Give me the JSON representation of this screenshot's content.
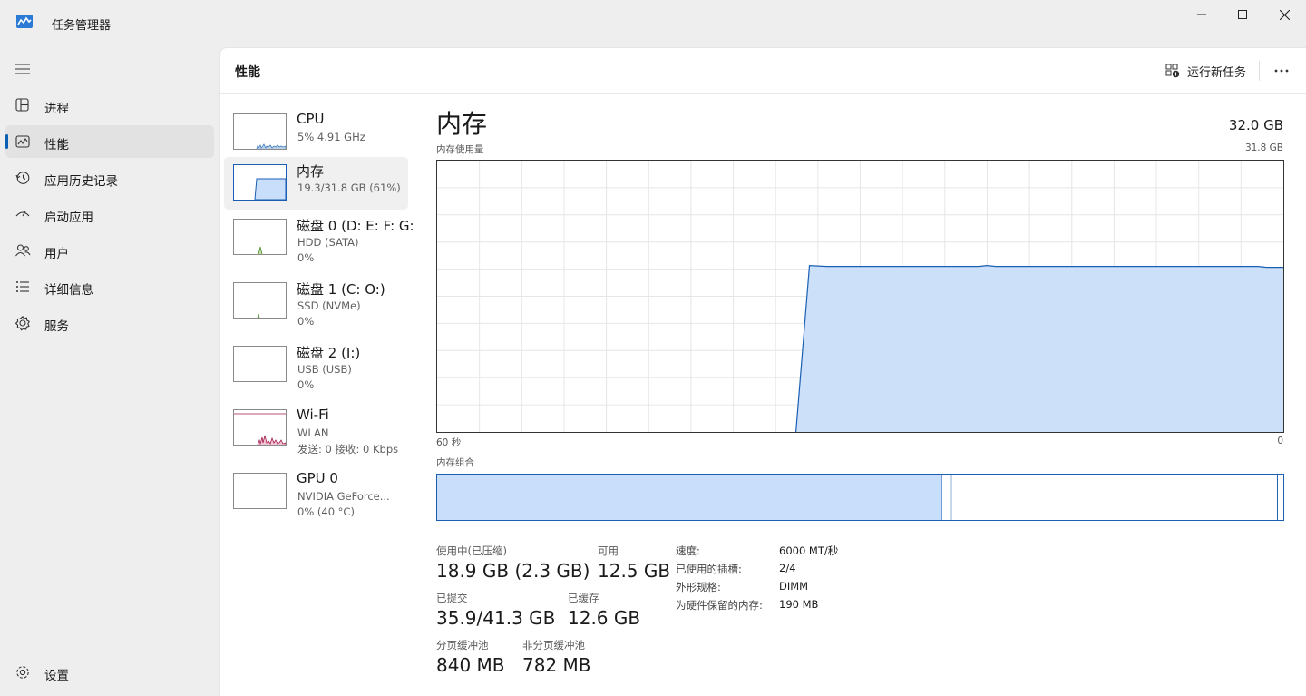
{
  "window": {
    "title": "任务管理器"
  },
  "nav": {
    "items": [
      {
        "label": "进程",
        "icon": "processes-icon"
      },
      {
        "label": "性能",
        "icon": "performance-icon",
        "active": true
      },
      {
        "label": "应用历史记录",
        "icon": "app-history-icon"
      },
      {
        "label": "启动应用",
        "icon": "startup-apps-icon"
      },
      {
        "label": "用户",
        "icon": "users-icon"
      },
      {
        "label": "详细信息",
        "icon": "details-icon"
      },
      {
        "label": "服务",
        "icon": "services-icon"
      }
    ],
    "settings_label": "设置"
  },
  "header": {
    "title": "性能",
    "run_task_label": "运行新任务",
    "more_label": "···"
  },
  "devices": [
    {
      "name": "CPU",
      "sub1": "5% 4.91 GHz",
      "sub2": ""
    },
    {
      "name": "内存",
      "sub1": "19.3/31.8 GB (61%)",
      "sub2": ""
    },
    {
      "name": "磁盘 0 (D: E: F: G:",
      "sub1": "HDD (SATA)",
      "sub2": "0%"
    },
    {
      "name": "磁盘 1 (C: O:)",
      "sub1": "SSD (NVMe)",
      "sub2": "0%"
    },
    {
      "name": "磁盘 2 (I:)",
      "sub1": "USB (USB)",
      "sub2": "0%"
    },
    {
      "name": "Wi-Fi",
      "sub1": "WLAN",
      "sub2": "发送: 0 接收: 0 Kbps"
    },
    {
      "name": "GPU 0",
      "sub1": "NVIDIA GeForce...",
      "sub2": "0% (40 °C)"
    }
  ],
  "memory": {
    "title": "内存",
    "total": "32.0 GB",
    "usage_label": "内存使用量",
    "usage_max": "31.8 GB",
    "axis_left": "60 秒",
    "axis_right": "0",
    "composition_label": "内存组合",
    "stats": {
      "in_use_label": "使用中(已压缩)",
      "in_use_value": "18.9 GB (2.3 GB)",
      "available_label": "可用",
      "available_value": "12.5 GB",
      "committed_label": "已提交",
      "committed_value": "35.9/41.3 GB",
      "cached_label": "已缓存",
      "cached_value": "12.6 GB",
      "paged_label": "分页缓冲池",
      "paged_value": "840 MB",
      "nonpaged_label": "非分页缓冲池",
      "nonpaged_value": "782 MB"
    },
    "specs": [
      {
        "key": "速度:",
        "value": "6000 MT/秒"
      },
      {
        "key": "已使用的插槽:",
        "value": "2/4"
      },
      {
        "key": "外形规格:",
        "value": "DIMM"
      },
      {
        "key": "为硬件保留的内存:",
        "value": "190 MB"
      }
    ],
    "composition": {
      "in_use_fraction": 0.597,
      "modified_fraction": 0.011,
      "standby_fraction": 0.385
    },
    "usage_fraction": 0.61
  },
  "colors": {
    "accent": "#0a5fb4",
    "memory_fill": "#c9defa",
    "memory_line": "#1a5fb4",
    "wifi": "#a5174c"
  }
}
